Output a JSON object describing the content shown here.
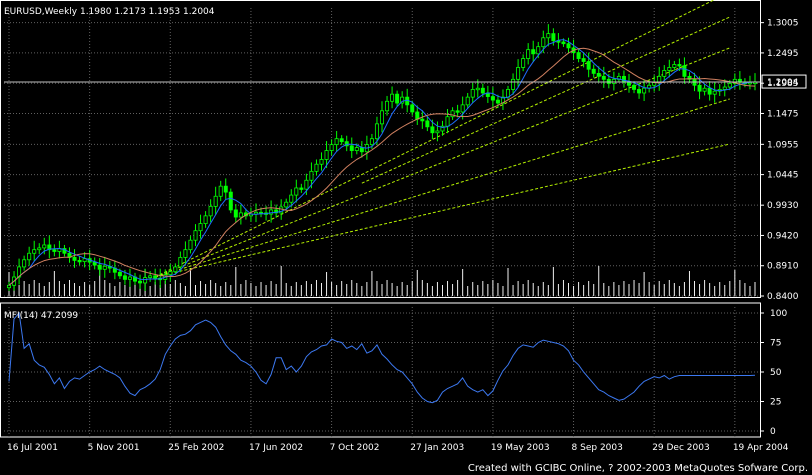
{
  "chart_data": {
    "type": "candlestick",
    "symbol_header": "EURUSD,Weekly  1.1980 1.2173 1.1953 1.2004",
    "current_price_label": "1.2004",
    "current_price": 1.2004,
    "ylim": [
      0.84,
      1.31
    ],
    "y_ticks": [
      "1.3005",
      "1.2495",
      "1.1985",
      "1.1475",
      "1.0955",
      "1.0445",
      "0.9930",
      "0.9420",
      "0.8910",
      "0.8400"
    ],
    "y_tick_values": [
      1.3005,
      1.2495,
      1.1985,
      1.1475,
      1.0955,
      1.0445,
      0.993,
      0.942,
      0.891,
      0.84
    ],
    "x_ticks": [
      "16 Jul 2001",
      "5 Nov 2001",
      "25 Feb 2002",
      "17 Jun 2002",
      "7 Oct 2002",
      "27 Jan 2003",
      "19 May 2003",
      "8 Sep 2003",
      "29 Dec 2003",
      "19 Apr 2004"
    ],
    "x_tick_week_index": [
      0,
      16,
      32,
      48,
      64,
      80,
      96,
      112,
      128,
      144
    ],
    "weeks": 149,
    "close": [
      0.858,
      0.872,
      0.889,
      0.901,
      0.912,
      0.918,
      0.921,
      0.926,
      0.918,
      0.915,
      0.92,
      0.912,
      0.905,
      0.9,
      0.898,
      0.903,
      0.897,
      0.892,
      0.885,
      0.89,
      0.887,
      0.88,
      0.874,
      0.868,
      0.872,
      0.865,
      0.862,
      0.871,
      0.874,
      0.87,
      0.868,
      0.876,
      0.881,
      0.889,
      0.905,
      0.918,
      0.934,
      0.95,
      0.962,
      0.975,
      0.991,
      1.008,
      1.025,
      1.015,
      0.985,
      0.973,
      0.98,
      0.975,
      0.978,
      0.981,
      0.98,
      0.978,
      0.985,
      0.98,
      0.99,
      0.998,
      1.01,
      1.022,
      1.02,
      1.035,
      1.05,
      1.062,
      1.07,
      1.085,
      1.095,
      1.105,
      1.1,
      1.093,
      1.085,
      1.09,
      1.083,
      1.095,
      1.105,
      1.13,
      1.152,
      1.168,
      1.18,
      1.165,
      1.175,
      1.162,
      1.15,
      1.138,
      1.135,
      1.125,
      1.115,
      1.118,
      1.126,
      1.142,
      1.152,
      1.15,
      1.162,
      1.175,
      1.188,
      1.19,
      1.182,
      1.176,
      1.17,
      1.165,
      1.175,
      1.188,
      1.205,
      1.225,
      1.24,
      1.255,
      1.248,
      1.26,
      1.275,
      1.282,
      1.27,
      1.268,
      1.265,
      1.258,
      1.25,
      1.24,
      1.235,
      1.222,
      1.215,
      1.21,
      1.205,
      1.198,
      1.205,
      1.21,
      1.2,
      1.195,
      1.188,
      1.182,
      1.19,
      1.195,
      1.2,
      1.21,
      1.22,
      1.225,
      1.23,
      1.228,
      1.21,
      1.205,
      1.195,
      1.185,
      1.19,
      1.18,
      1.185,
      1.188,
      1.192,
      1.198,
      1.205,
      1.2,
      1.198,
      1.2,
      1.2004
    ],
    "mfi_label": "MFI(14)  47.2099",
    "mfi_value": 47.2099,
    "mfi_ylim": [
      0,
      100
    ],
    "mfi_ticks": [
      "100",
      "75",
      "50",
      "25",
      "0"
    ],
    "mfi": [
      42,
      95,
      100,
      70,
      74,
      60,
      56,
      54,
      48,
      40,
      45,
      36,
      42,
      45,
      44,
      47,
      50,
      52,
      55,
      52,
      50,
      48,
      45,
      38,
      32,
      30,
      35,
      37,
      40,
      44,
      52,
      65,
      72,
      78,
      81,
      82,
      85,
      90,
      92,
      94,
      92,
      88,
      80,
      73,
      68,
      65,
      60,
      58,
      55,
      50,
      43,
      40,
      48,
      62,
      62,
      52,
      55,
      50,
      55,
      63,
      67,
      69,
      72,
      73,
      78,
      76,
      75,
      70,
      72,
      69,
      74,
      66,
      68,
      73,
      65,
      61,
      56,
      52,
      50,
      45,
      40,
      33,
      28,
      25,
      24,
      26,
      33,
      36,
      38,
      40,
      45,
      38,
      35,
      33,
      35,
      30,
      34,
      43,
      51,
      56,
      64,
      70,
      73,
      72,
      71,
      75,
      77,
      76,
      75,
      74,
      72,
      68,
      60,
      56,
      50,
      45,
      40,
      35,
      33,
      30,
      28,
      26,
      27,
      30,
      33,
      38,
      42,
      44,
      46,
      45,
      47,
      44,
      46,
      47,
      47,
      47,
      47,
      47,
      47,
      47,
      47,
      47,
      47,
      47,
      47,
      47,
      47,
      47,
      47.2
    ],
    "trend_fan": {
      "origin_week": 29,
      "origin_price": 0.872,
      "lines": [
        {
          "end_week": 143,
          "end_price": 1.352
        },
        {
          "end_week": 143,
          "end_price": 1.258
        },
        {
          "end_week": 143,
          "end_price": 1.172
        },
        {
          "end_week": 143,
          "end_price": 1.096
        }
      ],
      "channel": {
        "start_week": 70,
        "start_price": 1.03,
        "end_week": 143,
        "end_price": 1.31
      }
    },
    "colors": {
      "background": "#000000",
      "candle": "#00ff00",
      "grid": "#606060",
      "fast_ma": "#1e6cff",
      "slow_ma": "#d08060",
      "trend_lines": "#b4f000",
      "mfi_line": "#3c78f0",
      "volume": "#f0f0f0",
      "text": "#ffffff"
    }
  },
  "footer": {
    "credit": "Created with GCIBC Online, ? 2002-2003 MetaQuotes Sofware Corp."
  }
}
